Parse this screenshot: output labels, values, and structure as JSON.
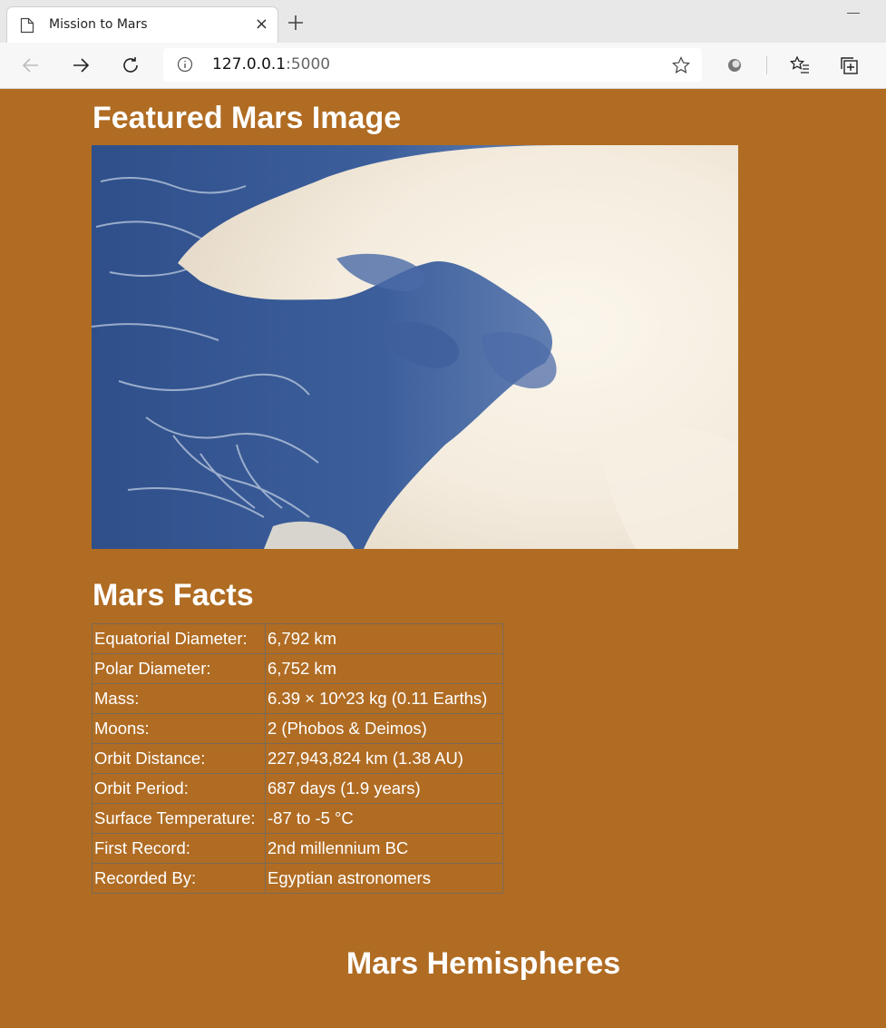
{
  "browser": {
    "tab_title": "Mission to Mars",
    "tab_close": "×",
    "url_host": "127.0.0.1",
    "url_port": ":5000"
  },
  "page": {
    "featured_heading": "Featured Mars Image",
    "facts_heading": "Mars Facts",
    "hemispheres_heading": "Mars Hemispheres",
    "facts": [
      {
        "label": "Equatorial Diameter:",
        "value": "6,792 km"
      },
      {
        "label": "Polar Diameter:",
        "value": "6,752 km"
      },
      {
        "label": "Mass:",
        "value": "6.39 × 10^23 kg (0.11 Earths)"
      },
      {
        "label": "Moons:",
        "value": "2 (Phobos & Deimos)"
      },
      {
        "label": "Orbit Distance:",
        "value": "227,943,824 km (1.38 AU)"
      },
      {
        "label": "Orbit Period:",
        "value": "687 days (1.9 years)"
      },
      {
        "label": "Surface Temperature:",
        "value": "-87 to -5 °C"
      },
      {
        "label": "First Record:",
        "value": "2nd millennium BC"
      },
      {
        "label": "Recorded By:",
        "value": "Egyptian astronomers"
      }
    ]
  },
  "colors": {
    "page_background": "#b06c23",
    "text": "#ffffff"
  },
  "icons": [
    "page-icon",
    "close-icon",
    "plus-icon",
    "back-arrow-icon",
    "forward-arrow-icon",
    "refresh-icon",
    "info-icon",
    "star-icon",
    "extension-icon",
    "favorites-icon",
    "collections-icon"
  ]
}
